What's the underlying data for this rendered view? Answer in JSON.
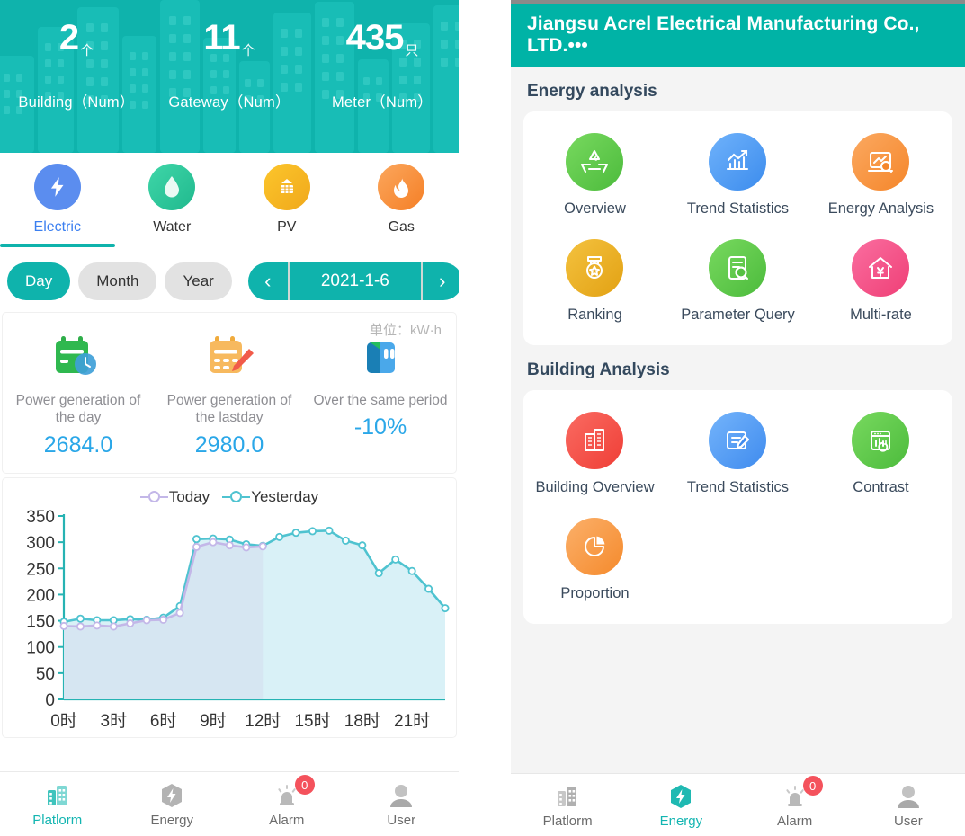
{
  "left": {
    "hero": {
      "stats": [
        {
          "value": "2",
          "unit": "个",
          "label": "Building（Num）"
        },
        {
          "value": "11",
          "unit": "个",
          "label": "Gateway（Num）"
        },
        {
          "value": "435",
          "unit": "只",
          "label": "Meter（Num）"
        }
      ]
    },
    "energy_tabs": [
      {
        "label": "Electric",
        "icon": "bolt-icon",
        "color": "#5b8def",
        "active": true
      },
      {
        "label": "Water",
        "icon": "water-drop-icon",
        "color": "#2ecc9b",
        "active": false
      },
      {
        "label": "PV",
        "icon": "solar-panel-icon",
        "color": "#f5b825",
        "active": false
      },
      {
        "label": "Gas",
        "icon": "flame-icon",
        "color": "#f7923a",
        "active": false
      }
    ],
    "period_segments": [
      {
        "label": "Day",
        "active": true
      },
      {
        "label": "Month",
        "active": false
      },
      {
        "label": "Year",
        "active": false
      }
    ],
    "date_nav": {
      "prev": "‹",
      "next": "›",
      "value": "2021-1-6"
    },
    "unit_tag": "单位：kW·h",
    "cards": [
      {
        "icon": "calendar-clock-icon",
        "label": "Power generation of the day",
        "value": "2684.0"
      },
      {
        "icon": "calendar-edit-icon",
        "label": "Power generation of the lastday",
        "value": "2980.0"
      },
      {
        "icon": "book-icon",
        "label": "Over the same period",
        "value": "-10%"
      }
    ],
    "tabbar": [
      {
        "label": "Platlorm",
        "icon": "building-icon",
        "active": true,
        "badge": null
      },
      {
        "label": "Energy",
        "icon": "energy-hex-icon",
        "active": false,
        "badge": null
      },
      {
        "label": "Alarm",
        "icon": "alarm-bell-icon",
        "active": false,
        "badge": "0"
      },
      {
        "label": "User",
        "icon": "user-icon",
        "active": false,
        "badge": null
      }
    ]
  },
  "chart_data": {
    "type": "line",
    "title": "",
    "xlabel": "",
    "ylabel": "",
    "ylim": [
      0,
      350
    ],
    "yticks": [
      0,
      50,
      100,
      150,
      200,
      250,
      300,
      350
    ],
    "xticks": [
      "0时",
      "3时",
      "6时",
      "9时",
      "12时",
      "15时",
      "18时",
      "21时"
    ],
    "grid": false,
    "legend_position": "top-center",
    "area_fill": true,
    "x": [
      0,
      1,
      2,
      3,
      4,
      5,
      6,
      7,
      8,
      9,
      10,
      11,
      12,
      13,
      14,
      15,
      16,
      17,
      18,
      19,
      20,
      21,
      22,
      23
    ],
    "series": [
      {
        "name": "Today",
        "color": "#c3b7e8",
        "fill": "#d6e6f2",
        "values": [
          140,
          139,
          141,
          139,
          145,
          151,
          152,
          165,
          291,
          300,
          294,
          290,
          292,
          null,
          null,
          null,
          null,
          null,
          null,
          null,
          null,
          null,
          null,
          null
        ]
      },
      {
        "name": "Yesterday",
        "color": "#4fc3d0",
        "fill": "#d9f1f7",
        "values": [
          148,
          154,
          151,
          151,
          153,
          152,
          156,
          178,
          306,
          307,
          305,
          296,
          293,
          310,
          318,
          321,
          322,
          303,
          294,
          241,
          267,
          245,
          211,
          174
        ]
      }
    ]
  },
  "right": {
    "header_title": "Jiangsu Acrel Electrical Manufacturing Co., LTD.•••",
    "sections": [
      {
        "title": "Energy analysis",
        "items": [
          {
            "label": "Overview",
            "icon": "recycle-icon",
            "color": "#5fc94e"
          },
          {
            "label": "Trend Statistics",
            "icon": "bar-chart-up-icon",
            "color": "#4e9bf5"
          },
          {
            "label": "Energy Analysis",
            "icon": "chart-search-icon",
            "color": "#f79331"
          },
          {
            "label": "Ranking",
            "icon": "medal-icon",
            "color": "#eeb022"
          },
          {
            "label": "Parameter Query",
            "icon": "doc-search-icon",
            "color": "#5fc94e"
          },
          {
            "label": "Multi-rate",
            "icon": "house-yuan-icon",
            "color": "#f2548a"
          }
        ]
      },
      {
        "title": "Building Analysis",
        "items": [
          {
            "label": "Building Overview",
            "icon": "building-red-icon",
            "color": "#f4564d"
          },
          {
            "label": "Trend Statistics",
            "icon": "doc-edit-icon",
            "color": "#55a3f7"
          },
          {
            "label": "Contrast",
            "icon": "chart-refresh-icon",
            "color": "#5fc94e"
          },
          {
            "label": "Proportion",
            "icon": "pie-chart-icon",
            "color": "#f79331"
          }
        ]
      }
    ],
    "tabbar": [
      {
        "label": "Platlorm",
        "icon": "building-icon",
        "active": false,
        "badge": null
      },
      {
        "label": "Energy",
        "icon": "energy-hex-icon",
        "active": true,
        "badge": null
      },
      {
        "label": "Alarm",
        "icon": "alarm-bell-icon",
        "active": false,
        "badge": "0"
      },
      {
        "label": "User",
        "icon": "user-icon",
        "active": false,
        "badge": null
      }
    ]
  }
}
